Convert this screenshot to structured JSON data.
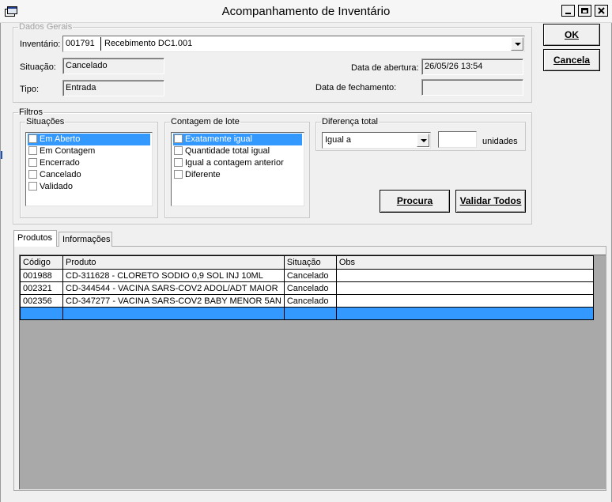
{
  "window": {
    "title": "Acompanhamento de Inventário"
  },
  "buttons": {
    "ok": "OK",
    "cancel": "Cancela",
    "search": "Procura",
    "validate_all": "Validar Todos"
  },
  "dados_gerais": {
    "legend": "Dados Gerais",
    "inventario_label": "Inventário:",
    "inventario_code": "001791",
    "inventario_name": "Recebimento DC1.001",
    "situacao_label": "Situação:",
    "situacao_value": "Cancelado",
    "tipo_label": "Tipo:",
    "tipo_value": "Entrada",
    "abertura_label": "Data de abertura:",
    "abertura_value": "26/05/26 13:54",
    "fechamento_label": "Data de fechamento:",
    "fechamento_value": ""
  },
  "filtros": {
    "legend": "Filtros",
    "situacoes": {
      "legend": "Situações",
      "items": [
        {
          "label": "Em Aberto",
          "checked": false,
          "selected": true
        },
        {
          "label": "Em Contagem",
          "checked": false,
          "selected": false
        },
        {
          "label": "Encerrado",
          "checked": false,
          "selected": false
        },
        {
          "label": "Cancelado",
          "checked": false,
          "selected": false
        },
        {
          "label": "Validado",
          "checked": false,
          "selected": false
        }
      ]
    },
    "contagem": {
      "legend": "Contagem de lote",
      "items": [
        {
          "label": "Exatamente igual",
          "checked": false,
          "selected": true
        },
        {
          "label": "Quantidade total igual",
          "checked": false,
          "selected": false
        },
        {
          "label": "Igual a contagem anterior",
          "checked": false,
          "selected": false
        },
        {
          "label": "Diferente",
          "checked": false,
          "selected": false
        }
      ]
    },
    "diferenca": {
      "legend": "Diferença total",
      "operator": "Igual a",
      "quantity": "",
      "units_label": "unidades"
    }
  },
  "tabs": [
    {
      "label": "Produtos",
      "active": true
    },
    {
      "label": "Informações",
      "active": false
    }
  ],
  "grid": {
    "columns": [
      "Código",
      "Produto",
      "Situação",
      "Obs"
    ],
    "rows": [
      {
        "codigo": "001988",
        "produto": "CD-311628 - CLORETO SODIO 0,9 SOL INJ 10ML",
        "situacao": "Cancelado",
        "obs": ""
      },
      {
        "codigo": "002321",
        "produto": "CD-344544 - VACINA SARS-COV2 ADOL/ADT MAIOR",
        "situacao": "Cancelado",
        "obs": ""
      },
      {
        "codigo": "002356",
        "produto": "CD-347277 - VACINA SARS-COV2 BABY MENOR 5AN",
        "situacao": "Cancelado",
        "obs": ""
      }
    ]
  },
  "colors": {
    "selection": "#3399ff",
    "window_bg": "#f0f0f0",
    "grid_bg": "#a9a9a9"
  }
}
